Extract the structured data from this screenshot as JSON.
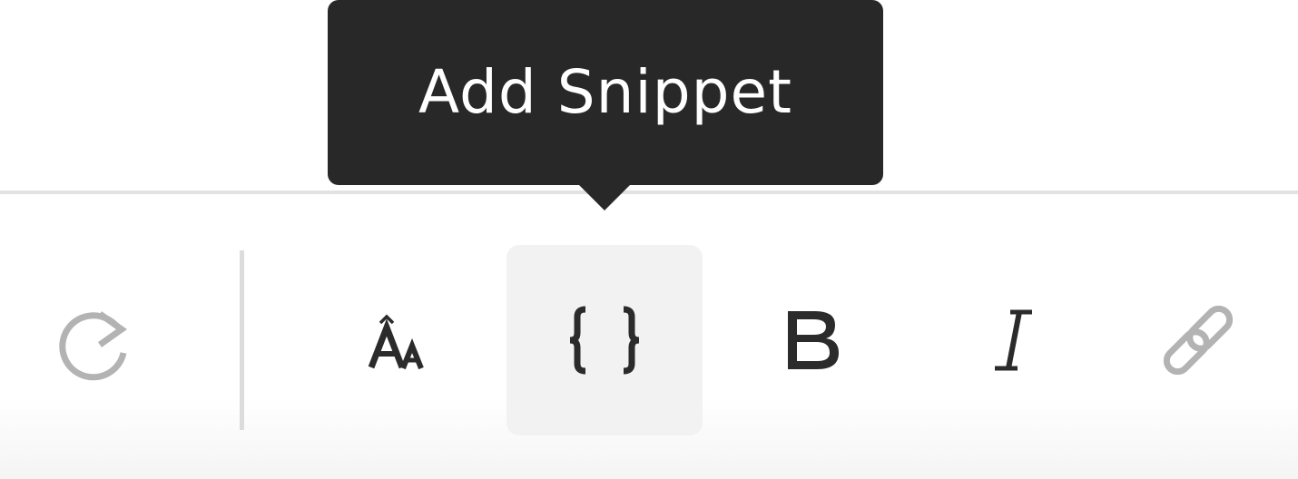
{
  "tooltip": {
    "text": "Add Snippet"
  },
  "toolbar": {
    "buttons": [
      {
        "name": "redo",
        "icon": "redo-icon",
        "enabled": false
      },
      {
        "name": "text-size",
        "icon": "text-size-icon",
        "enabled": true
      },
      {
        "name": "snippet",
        "icon": "code-braces-icon",
        "enabled": true,
        "active": true
      },
      {
        "name": "bold",
        "icon": "bold-icon",
        "enabled": true
      },
      {
        "name": "italic",
        "icon": "italic-icon",
        "enabled": true
      },
      {
        "name": "link",
        "icon": "link-icon",
        "enabled": false
      }
    ]
  },
  "colors": {
    "tooltip_bg": "#282828",
    "icon_active": "#2b2b2b",
    "icon_disabled": "#b3b3b3",
    "active_bg": "#f2f2f2",
    "divider": "#e2e2e2"
  }
}
